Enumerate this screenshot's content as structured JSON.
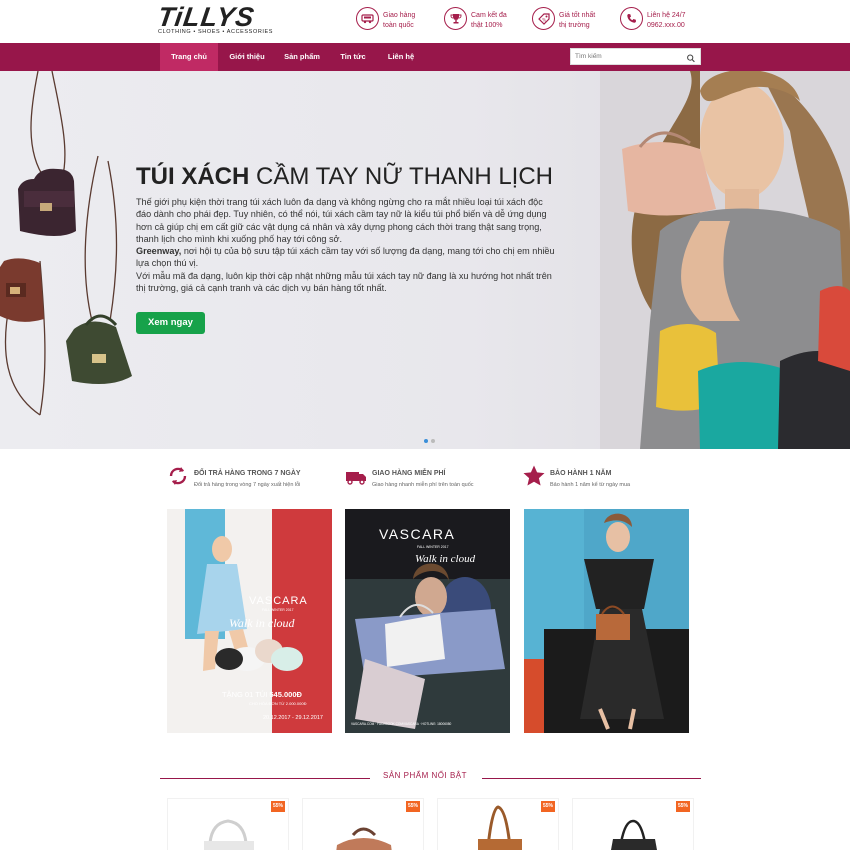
{
  "header": {
    "logo": "TiLLYS",
    "logo_tagline": "CLOTHING • SHOES • ACCESSORIES",
    "infos": [
      {
        "icon": "truck-icon",
        "line1": "Giao hàng",
        "line2": "toàn quốc"
      },
      {
        "icon": "trophy-icon",
        "line1": "Cam kết đa",
        "line2": "thật 100%"
      },
      {
        "icon": "tag-icon",
        "line1": "Giá tốt nhất",
        "line2": "thị trường"
      },
      {
        "icon": "phone-icon",
        "line1": "Liên hệ 24/7",
        "line2": "0962.xxx.00"
      }
    ]
  },
  "nav": {
    "items": [
      "Trang chủ",
      "Giới thiệu",
      "Sản phẩm",
      "Tin tức",
      "Liên hệ"
    ],
    "active_index": 0,
    "search_placeholder": "Tìm kiếm"
  },
  "banner": {
    "title_bold": "TÚI XÁCH",
    "title_rest": " CẦM TAY NỮ THANH LỊCH",
    "para1": "Thế giới phụ kiện thời trang túi xách luôn đa dạng và không ngừng cho ra mắt nhiều loại túi xách độc đáo dành cho phái đẹp. Tuy nhiên, có thể nói, túi xách cầm tay nữ là kiểu túi phổ biến và dễ ứng dụng hơn cả giúp chị em cất giữ các vật dụng cá nhân và xây dựng phong cách thời trang thật sang trọng, thanh lịch cho mình khi xuống phố hay tới công sở.",
    "para2_bold": "Greenway,",
    "para2_rest": " nơi hội tụ của bộ sưu tập túi xách cầm tay với số lượng đa dạng, mang tới cho chị em nhiều lựa chọn thú vị.",
    "para3": "Với mẫu mã đa dạng, luôn kịp thời cập nhật những mẫu túi xách tay nữ đang là xu hướng hot nhất trên thị trường, giá cả cạnh tranh và các dịch vụ bán hàng tốt nhất.",
    "button": "Xem ngay",
    "slides": 2,
    "active_slide": 0
  },
  "features": [
    {
      "icon": "return-icon",
      "title": "ĐỔI TRẢ HÀNG TRONG 7 NGÀY",
      "desc": "Đổi trả hàng trong vòng 7 ngày xuất hiện lỗi"
    },
    {
      "icon": "delivery-truck-icon",
      "title": "GIAO HÀNG MIỄN PHÍ",
      "desc": "Giao hàng nhanh miễn phí trên toàn quốc"
    },
    {
      "icon": "star-icon",
      "title": "BẢO HÀNH 1 NĂM",
      "desc": "Bảo hành 1 năm kể từ ngày mua"
    }
  ],
  "promos": [
    {
      "brand": "VASCARA",
      "season": "FALL WINTER 2017",
      "script": "Walk in cloud",
      "offer_prefix": "TẶNG 01 TÚI",
      "offer_price": "545.000Đ",
      "offer_note": "CHO HÓA ĐƠN TỪ 2.000.000Đ",
      "dates": "20.12.2017 - 29.12.2017"
    },
    {
      "brand": "VASCARA",
      "season": "FALL WINTER 2017",
      "script": "Walk in cloud",
      "footer": "VASCARA.COM  ·  FACEBOOK.COM/VASCARA  ·  HOTLINE: 18006080"
    },
    {
      "brand": "",
      "season": "",
      "script": ""
    }
  ],
  "section": {
    "title": "SẢN PHẨM NỔI BẬT"
  },
  "products": [
    {
      "badge": "55%"
    },
    {
      "badge": "55%"
    },
    {
      "badge": "55%"
    },
    {
      "badge": "55%"
    }
  ],
  "colors": {
    "brand": "#97164a",
    "accent": "#a51e4b",
    "button_green": "#17a24a",
    "sale_orange": "#f26522"
  }
}
